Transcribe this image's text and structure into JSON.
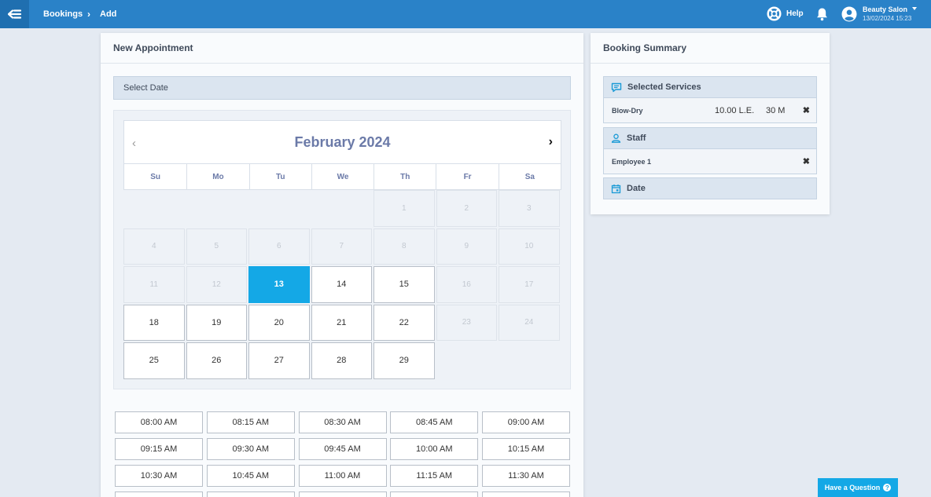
{
  "topbar": {
    "breadcrumb": [
      "Bookings",
      "Add"
    ],
    "breadcrumb_sep": "›",
    "help_label": "Help",
    "user_name": "Beauty Salon",
    "user_date": "13/02/2024 15:23"
  },
  "appointment": {
    "title": "New Appointment",
    "select_date_label": "Select Date",
    "calendar": {
      "month_label": "February 2024",
      "prev_symbol": "‹",
      "next_symbol": "›",
      "weekdays": [
        "Su",
        "Mo",
        "Tu",
        "We",
        "Th",
        "Fr",
        "Sa"
      ],
      "selected_day": 13,
      "days": [
        {
          "label": "",
          "state": "blank"
        },
        {
          "label": "",
          "state": "blank"
        },
        {
          "label": "",
          "state": "blank"
        },
        {
          "label": "",
          "state": "blank"
        },
        {
          "label": "1",
          "state": "past"
        },
        {
          "label": "2",
          "state": "past"
        },
        {
          "label": "3",
          "state": "past"
        },
        {
          "label": "4",
          "state": "past"
        },
        {
          "label": "5",
          "state": "past"
        },
        {
          "label": "6",
          "state": "past"
        },
        {
          "label": "7",
          "state": "past"
        },
        {
          "label": "8",
          "state": "past"
        },
        {
          "label": "9",
          "state": "past"
        },
        {
          "label": "10",
          "state": "past"
        },
        {
          "label": "11",
          "state": "past"
        },
        {
          "label": "12",
          "state": "past"
        },
        {
          "label": "13",
          "state": "sel"
        },
        {
          "label": "14",
          "state": "avail"
        },
        {
          "label": "15",
          "state": "avail"
        },
        {
          "label": "16",
          "state": "off"
        },
        {
          "label": "17",
          "state": "off"
        },
        {
          "label": "18",
          "state": "avail"
        },
        {
          "label": "19",
          "state": "avail"
        },
        {
          "label": "20",
          "state": "avail"
        },
        {
          "label": "21",
          "state": "avail"
        },
        {
          "label": "22",
          "state": "avail"
        },
        {
          "label": "23",
          "state": "off"
        },
        {
          "label": "24",
          "state": "off"
        },
        {
          "label": "25",
          "state": "avail"
        },
        {
          "label": "26",
          "state": "avail"
        },
        {
          "label": "27",
          "state": "avail"
        },
        {
          "label": "28",
          "state": "avail"
        },
        {
          "label": "29",
          "state": "avail"
        }
      ]
    },
    "time_slots": [
      "08:00 AM",
      "08:15 AM",
      "08:30 AM",
      "08:45 AM",
      "09:00 AM",
      "09:15 AM",
      "09:30 AM",
      "09:45 AM",
      "10:00 AM",
      "10:15 AM",
      "10:30 AM",
      "10:45 AM",
      "11:00 AM",
      "11:15 AM",
      "11:30 AM",
      "",
      "",
      "",
      "",
      ""
    ]
  },
  "summary": {
    "title": "Booking Summary",
    "services_label": "Selected Services",
    "service": {
      "name": "Blow-Dry",
      "price": "10.00 L.E.",
      "duration": "30 M"
    },
    "staff_label": "Staff",
    "staff_name": "Employee 1",
    "date_label": "Date",
    "remove_symbol": "✖"
  },
  "help_widget": {
    "label": "Have a Question",
    "icon_text": "?"
  },
  "colors": {
    "topbar": "#2a82c8",
    "accent": "#14a8e6",
    "calendar_title": "#6b7aa8"
  },
  "icons": [
    "menu-back-icon",
    "lifebuoy-icon",
    "bell-icon",
    "user-circle-icon",
    "comment-icon",
    "person-icon",
    "calendar-icon",
    "question-icon"
  ]
}
